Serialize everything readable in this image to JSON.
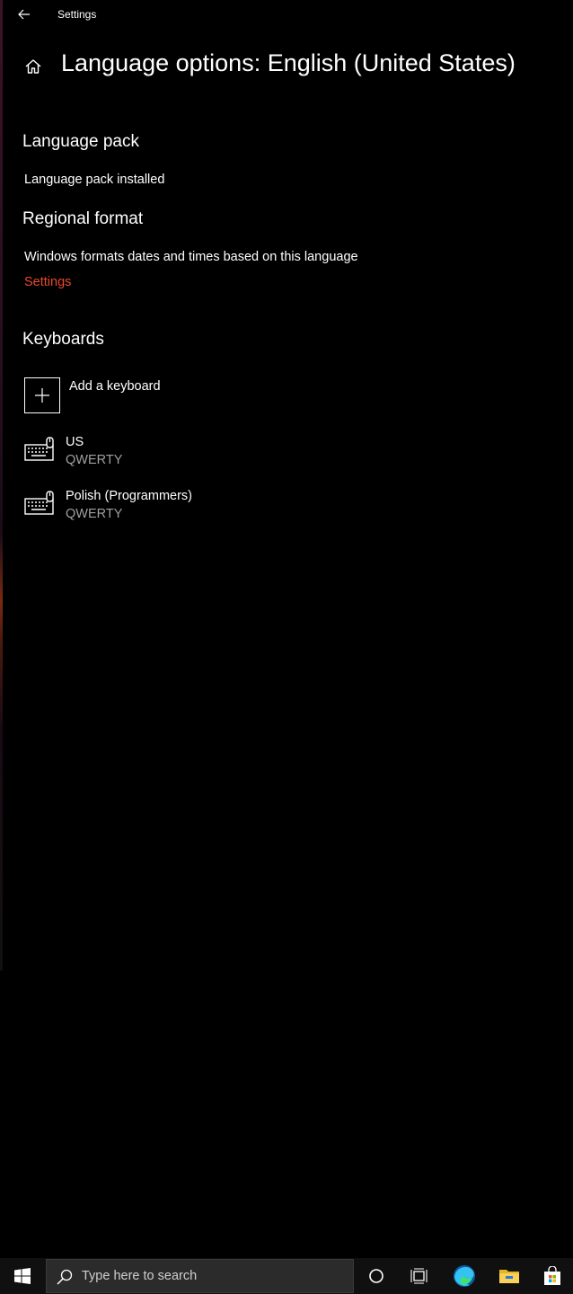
{
  "window": {
    "app_title": "Settings",
    "page_title": "Language options: English (United States)"
  },
  "icons": {
    "back": "back-arrow-icon",
    "home": "home-icon",
    "add": "plus-icon",
    "keyboard": "keyboard-icon"
  },
  "language_pack": {
    "heading": "Language pack",
    "status": "Language pack installed"
  },
  "regional_format": {
    "heading": "Regional format",
    "description": "Windows formats dates and times based on this language",
    "link": "Settings"
  },
  "keyboards": {
    "heading": "Keyboards",
    "add_label": "Add a keyboard",
    "items": [
      {
        "name": "US",
        "layout": "QWERTY"
      },
      {
        "name": "Polish (Programmers)",
        "layout": "QWERTY"
      }
    ]
  },
  "taskbar": {
    "search_placeholder": "Type here to search",
    "buttons": [
      "windows-logo-icon",
      "cortana-circle-icon",
      "task-view-icon",
      "edge-icon",
      "file-explorer-icon",
      "store-icon"
    ]
  },
  "colors": {
    "background": "#000000",
    "accent_link": "#e8492b",
    "secondary_text": "#a0a0a0",
    "taskbar": "#101010",
    "search_box": "#2b2b2b"
  }
}
